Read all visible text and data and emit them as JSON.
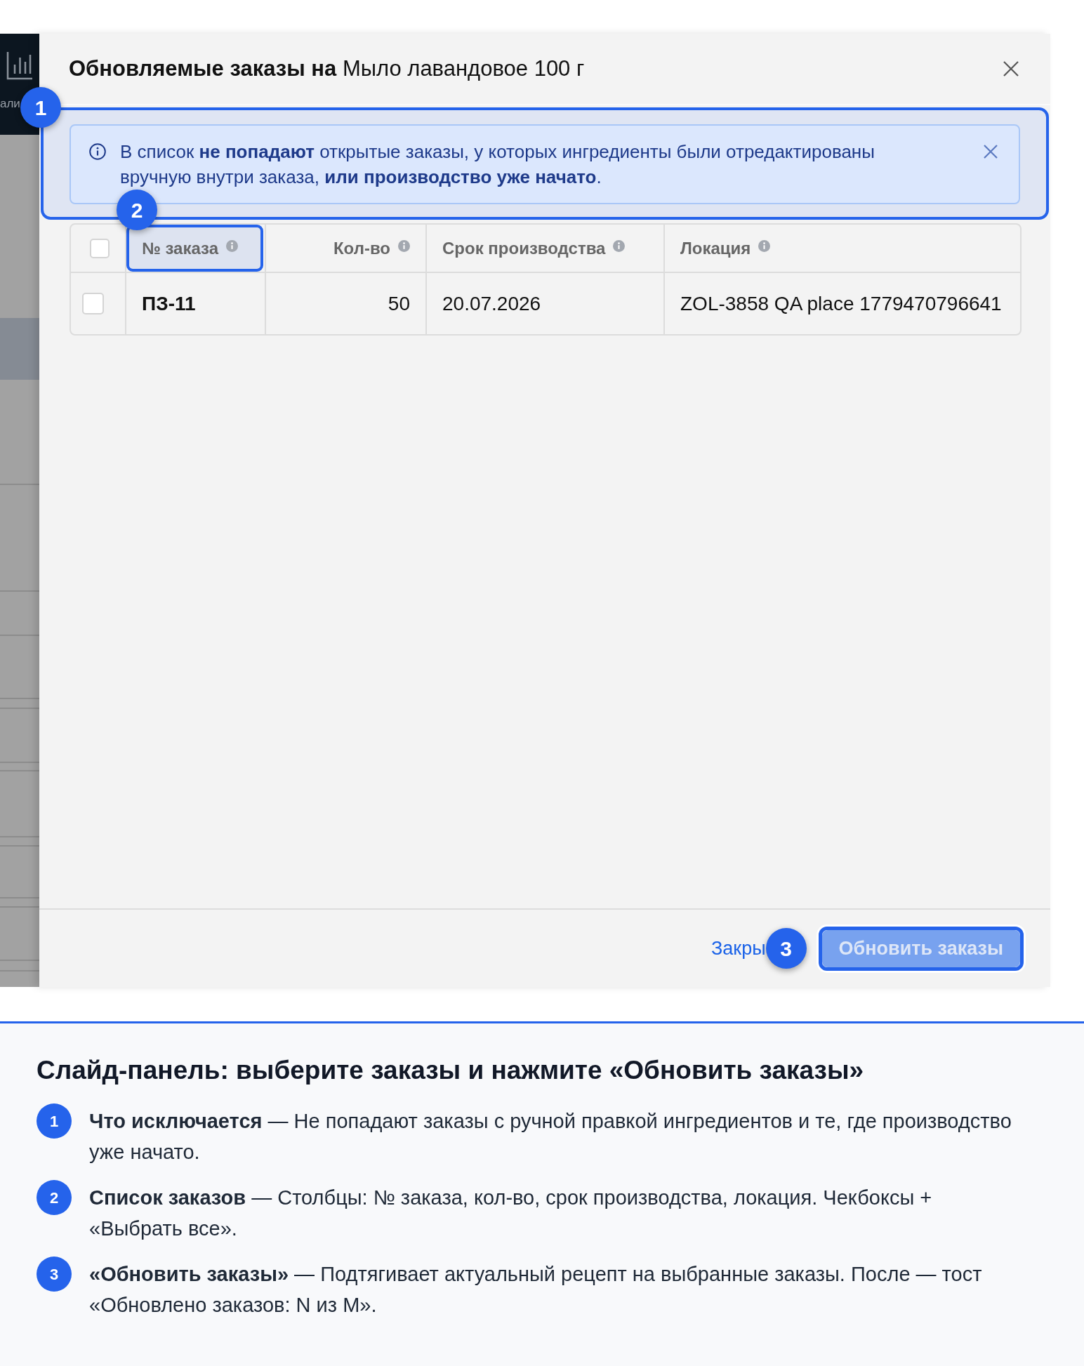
{
  "sidebar": {
    "label": "али"
  },
  "panel": {
    "title": "**Обновляемые заказы на** Мыло лавандовое 100 г",
    "alert": {
      "text": "В список **не попадают** открытые заказы, у которых ингредиенты были отредактированы вручную внутри заказа, **или производство уже начато**.",
      "annotation": "1"
    },
    "table": {
      "select_all": {
        "checked": false
      },
      "columns": [
        {
          "label": "№ заказа",
          "kind": "id",
          "annotation": "2"
        },
        {
          "label": "Кол-во",
          "kind": "number"
        },
        {
          "label": "Срок производства",
          "kind": "date"
        },
        {
          "label": "Локация",
          "kind": "text"
        }
      ],
      "rows": [
        {
          "selected": false,
          "cells": [
            "ПЗ-11",
            "50",
            "20.07.2026",
            "ZOL-3858 QA place 1779470796641"
          ]
        }
      ]
    },
    "footer": {
      "close_link": "Закры",
      "submit_button": {
        "label": "Обновить заказы",
        "disabled": true,
        "annotation": "3"
      }
    }
  },
  "legend": {
    "title": "Слайд-панель: выберите заказы и нажмите «Обновить заказы»",
    "items": [
      {
        "number": "1",
        "text": "**Что исключается** — Не попадают заказы с ручной правкой ингредиентов и те, где производство уже начато."
      },
      {
        "number": "2",
        "text": "**Список заказов** — Столбцы: № заказа, кол-во, срок производства, локация. Чекбоксы + «Выбрать все»."
      },
      {
        "number": "3",
        "text": "**«Обновить заказы»** — Подтягивает актуальный рецепт на выбранные заказы. После — тост «Обновлено заказов: N из M»."
      }
    ]
  }
}
